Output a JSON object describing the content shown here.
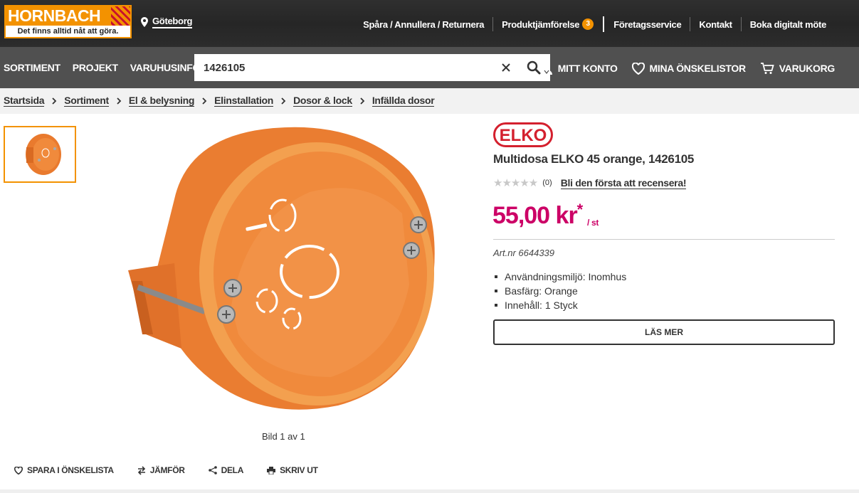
{
  "header": {
    "logo_text": "HORNBACH",
    "logo_tagline": "Det finns alltid nåt att göra.",
    "location": "Göteborg",
    "links": [
      {
        "label": "Spåra / Annullera / Returnera"
      },
      {
        "label": "Produktjämförelse",
        "badge": "3"
      },
      {
        "label": "Företagsservice"
      },
      {
        "label": "Kontakt"
      },
      {
        "label": "Boka digitalt möte"
      }
    ]
  },
  "nav": {
    "items": [
      "SORTIMENT",
      "PROJEKT",
      "VARUHUSINFO"
    ],
    "search_value": "1426105",
    "account": "MITT KONTO",
    "wishlists": "MINA ÖNSKELISTOR",
    "cart": "VARUKORG"
  },
  "breadcrumb": [
    "Startsida",
    "Sortiment",
    "El & belysning",
    "Elinstallation",
    "Dosor & lock",
    "Infällda dosor"
  ],
  "gallery": {
    "caption": "Bild 1 av 1"
  },
  "actions": [
    "SPARA I ÖNSKELISTA",
    "JÄMFÖR",
    "DELA",
    "SKRIV UT"
  ],
  "product": {
    "brand": "ELKO",
    "title": "Multidosa ELKO 45 orange, 1426105",
    "stars": "★★★★★",
    "review_count": "(0)",
    "review_link": "Bli den första att recensera!",
    "price": "55,00 kr",
    "price_asterisk": "*",
    "price_unit": "/ st",
    "article_number": "Art.nr 6644339",
    "features": [
      "Användningsmiljö: Inomhus",
      "Basfärg: Orange",
      "Innehåll: 1 Styck"
    ],
    "read_more": "LÄS MER"
  },
  "colors": {
    "brand_orange": "#f39200",
    "price_magenta": "#cc0066",
    "nav_gray": "#505050",
    "topbar_dark": "#2a2a2a",
    "elko_red": "#d4202e"
  }
}
